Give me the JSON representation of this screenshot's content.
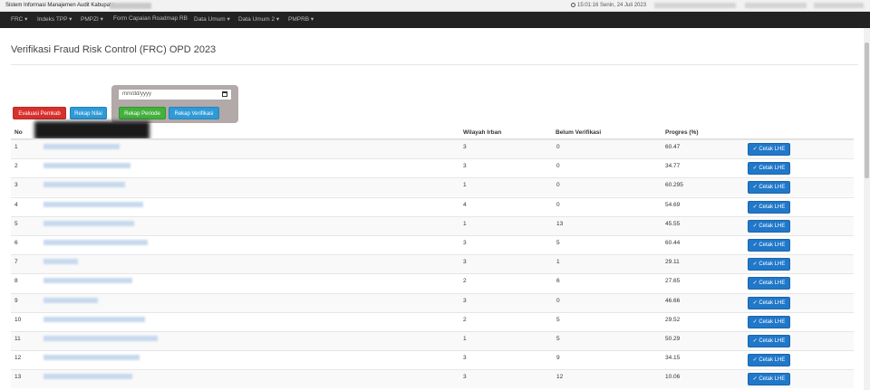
{
  "topbar": {
    "system_name": "Sistem Informasi Manajemen Audit Kabupate",
    "datetime": "15:01:16 Senin, 24 Juli 2023"
  },
  "nav": [
    {
      "label": "FRC ▾"
    },
    {
      "label": "Indeks TPP ▾"
    },
    {
      "label": "PMPZI ▾"
    },
    {
      "label": "Form Capaian Roadmap RB"
    },
    {
      "label": "Data Umum ▾"
    },
    {
      "label": "Data Umum 2 ▾"
    },
    {
      "label": "PMPRB ▾"
    }
  ],
  "page": {
    "title": "Verifikasi Fraud Risk Control (FRC) OPD 2023"
  },
  "toolbar": {
    "evaluasi_label": "Evaluasi Pemkab",
    "rekap_nilai_label": "Rekap Nilai",
    "date_placeholder": "mm/dd/yyyy",
    "rekap_periode_label": "Rekap Periode",
    "rekap_verifikasi_label": "Rekap Verifikasi"
  },
  "table": {
    "headers": {
      "no": "No",
      "wilayah": "Wilayah Irban",
      "belum": "Belum Verifikasi",
      "progres": "Progres (%)"
    },
    "action_label": "✓ Cetak LHE",
    "rows": [
      {
        "no": "1",
        "wilayah": "3",
        "belum": "0",
        "progres": "60.47"
      },
      {
        "no": "2",
        "wilayah": "3",
        "belum": "0",
        "progres": "34.77"
      },
      {
        "no": "3",
        "wilayah": "1",
        "belum": "0",
        "progres": "60.295"
      },
      {
        "no": "4",
        "wilayah": "4",
        "belum": "0",
        "progres": "54.69"
      },
      {
        "no": "5",
        "wilayah": "1",
        "belum": "13",
        "progres": "45.55"
      },
      {
        "no": "6",
        "wilayah": "3",
        "belum": "5",
        "progres": "60.44"
      },
      {
        "no": "7",
        "wilayah": "3",
        "belum": "1",
        "progres": "29.11"
      },
      {
        "no": "8",
        "wilayah": "2",
        "belum": "6",
        "progres": "27.65"
      },
      {
        "no": "9",
        "wilayah": "3",
        "belum": "0",
        "progres": "46.66"
      },
      {
        "no": "10",
        "wilayah": "2",
        "belum": "5",
        "progres": "29.52"
      },
      {
        "no": "11",
        "wilayah": "1",
        "belum": "5",
        "progres": "50.29"
      },
      {
        "no": "12",
        "wilayah": "3",
        "belum": "9",
        "progres": "34.15"
      },
      {
        "no": "13",
        "wilayah": "3",
        "belum": "12",
        "progres": "10.06"
      }
    ]
  }
}
